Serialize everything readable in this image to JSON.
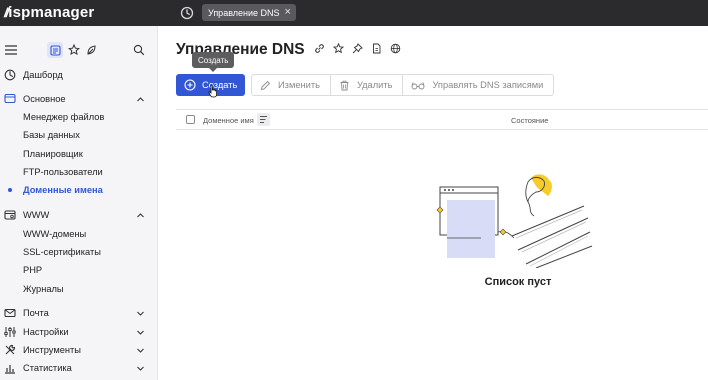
{
  "app": {
    "logo_mark": "//",
    "logo_name": "ispmanager"
  },
  "topbar": {
    "tab_label": "Управление DNS",
    "tab_close": "×"
  },
  "sidebar": {
    "items": [
      {
        "label": "Дашборд"
      },
      {
        "label": "Основное"
      },
      {
        "label": "Менеджер файлов"
      },
      {
        "label": "Базы данных"
      },
      {
        "label": "Планировщик"
      },
      {
        "label": "FTP-пользователи"
      },
      {
        "label": "Доменные имена"
      },
      {
        "label": "WWW"
      },
      {
        "label": "WWW-домены"
      },
      {
        "label": "SSL-сертификаты"
      },
      {
        "label": "PHP"
      },
      {
        "label": "Журналы"
      },
      {
        "label": "Почта"
      },
      {
        "label": "Настройки"
      },
      {
        "label": "Инструменты"
      },
      {
        "label": "Статистика"
      }
    ]
  },
  "main": {
    "title": "Управление DNS",
    "tooltip": "Создать",
    "toolbar": {
      "create": "Создать",
      "edit": "Изменить",
      "delete": "Удалить",
      "manage": "Управлять DNS записями"
    },
    "table": {
      "col_domain": "Доменное имя",
      "col_status": "Состояние"
    },
    "empty_text": "Список пуст"
  },
  "colors": {
    "accent": "#3157d5",
    "topbar": "#2b2b2e",
    "sidebar_bg": "#f5f5f7"
  }
}
